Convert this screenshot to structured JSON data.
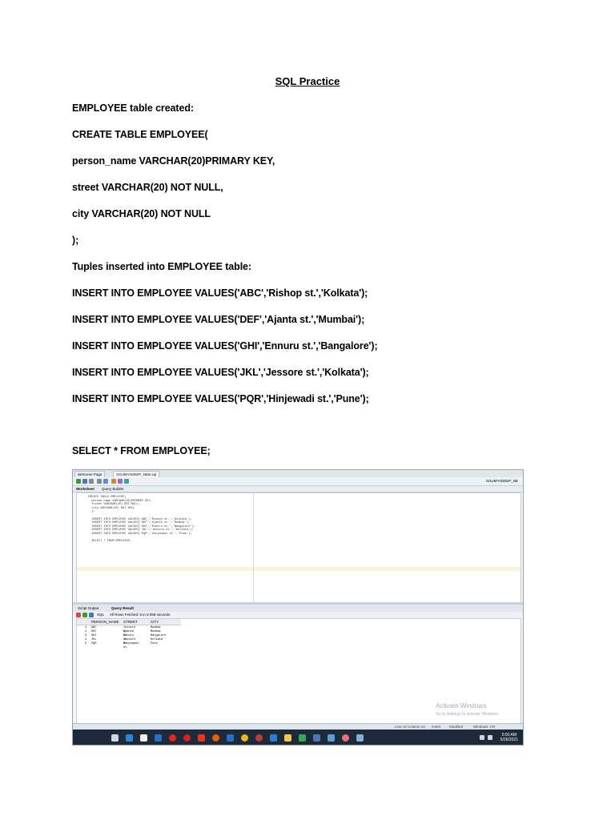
{
  "document": {
    "title": "SQL Practice",
    "lines": [
      "EMPLOYEE table created:",
      "CREATE TABLE EMPLOYEE(",
      "person_name VARCHAR(20)PRIMARY KEY,",
      "street VARCHAR(20) NOT NULL,",
      "city VARCHAR(20) NOT NULL",
      ");",
      "Tuples inserted into EMPLOYEE table:",
      "INSERT INTO EMPLOYEE VALUES('ABC','Rishop st.','Kolkata');",
      "INSERT INTO EMPLOYEE VALUES('DEF','Ajanta st.','Mumbai');",
      "INSERT INTO EMPLOYEE VALUES('GHI','Ennuru st.','Bangalore');",
      "INSERT INTO EMPLOYEE VALUES('JKL','Jessore st.','Kolkata');",
      "INSERT INTO EMPLOYEE VALUES('PQR','Hinjewadi st.','Pune');",
      "SELECT * FROM EMPLOYEE;"
    ]
  },
  "screenshot": {
    "tabs": [
      "Welcome Page",
      "SOUMYADEEP_NEB.sql"
    ],
    "connection": "SOUMYADEEP_NE",
    "subtabs": [
      "Worksheet",
      "Query Builder"
    ],
    "code": "CREATE TABLE EMPLOYEE(\n  person_name VARCHAR(20)PRIMARY KEY,\n  street VARCHAR(20) NOT NULL,\n  city VARCHAR(20) NOT NULL\n  );\n\n  INSERT INTO EMPLOYEE VALUES('ABC','Rishop st.','Kolkata');\n  INSERT INTO EMPLOYEE VALUES('DEF','Ajanta st.','Mumbai');\n  INSERT INTO EMPLOYEE VALUES('GHI','Ennuru st.','Bangalore');\n  INSERT INTO EMPLOYEE VALUES('JKL','Jessore st.','Kolkata');\n  INSERT INTO EMPLOYEE VALUES('PQR','Hinjewadi st.','Pune');\n\n  SELECT * FROM EMPLOYEE;",
    "output_tabs": [
      "Script Output",
      "Query Result"
    ],
    "sql_label": "SQL",
    "fetch_message": "All Rows Fetched: 5 in 0.058 seconds",
    "columns": [
      "PERSON_NAME",
      "STREET",
      "CITY"
    ],
    "rows": [
      [
        "1",
        "ABC",
        "Jessore st.",
        "Mumbai"
      ],
      [
        "2",
        "DEF",
        "Ajanta st.",
        "Mumbai"
      ],
      [
        "3",
        "GHI",
        "Ennuru st.",
        "Bangalore"
      ],
      [
        "4",
        "JKL",
        "Jessore st.",
        "Kolkata"
      ],
      [
        "5",
        "PQR",
        "Hinjewadi st.",
        "Pune"
      ]
    ],
    "watermark_title": "Activate Windows",
    "watermark_sub": "Go to Settings to activate Windows.",
    "status": [
      "Line 12 Column 24",
      "Insert",
      "Modified",
      "Windows: CR"
    ],
    "clock_time": "5:50 AM",
    "clock_date": "5/26/2021"
  }
}
